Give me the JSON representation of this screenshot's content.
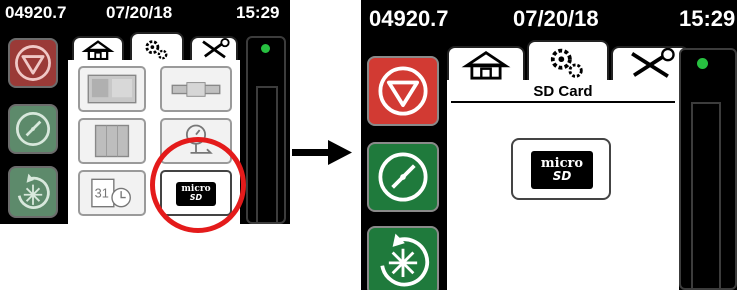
{
  "before_screen": {
    "status": {
      "odometer": "04920.7",
      "date": "07/20/18",
      "time": "15:29"
    },
    "sidebar": [
      {
        "name": "stop-button",
        "icon": "stop-icon"
      },
      {
        "name": "gauge-button",
        "icon": "gauge-icon"
      },
      {
        "name": "defrost-button",
        "icon": "defrost-icon"
      }
    ],
    "tabs": [
      {
        "name": "tab-home",
        "icon": "home-icon"
      },
      {
        "name": "tab-settings",
        "icon": "gears-icon",
        "selected": true
      },
      {
        "name": "tab-tools",
        "icon": "wrench-screwdriver-icon"
      }
    ],
    "tiles": [
      {
        "name": "unit-tile",
        "icon": "reefer-unit-icon"
      },
      {
        "name": "sensor-tile",
        "icon": "sensor-probe-icon"
      },
      {
        "name": "panel-tile",
        "icon": "control-panel-icon"
      },
      {
        "name": "clock-tile",
        "icon": "clock-gauge-icon"
      },
      {
        "name": "calendar-clock-tile",
        "icon": "calendar-clock-icon",
        "calendar_text": "31"
      },
      {
        "name": "sd-card-tile",
        "icon": "micro-sd-icon"
      }
    ],
    "sd_logo": {
      "micro": "micro",
      "sd": "SD"
    },
    "highlight": {
      "target": "sd-card-tile",
      "color": "#e41b1b"
    }
  },
  "after_screen": {
    "status": {
      "odometer": "04920.7",
      "date": "07/20/18",
      "time": "15:29"
    },
    "sidebar": [
      {
        "name": "stop-button",
        "icon": "stop-icon"
      },
      {
        "name": "gauge-button",
        "icon": "gauge-icon"
      },
      {
        "name": "defrost-button",
        "icon": "defrost-icon"
      }
    ],
    "panel_title": "SD Card",
    "sd_logo": {
      "micro": "micro",
      "sd": "SD"
    }
  },
  "transition_arrow": "right-arrow-icon",
  "colors": {
    "stop_red": "#d23a33",
    "stop_red_dim": "#9a3a37",
    "green": "#1f7a3c",
    "green_dim": "#5d8a6b",
    "led_green": "#27c040",
    "highlight_red": "#e41b1b"
  }
}
